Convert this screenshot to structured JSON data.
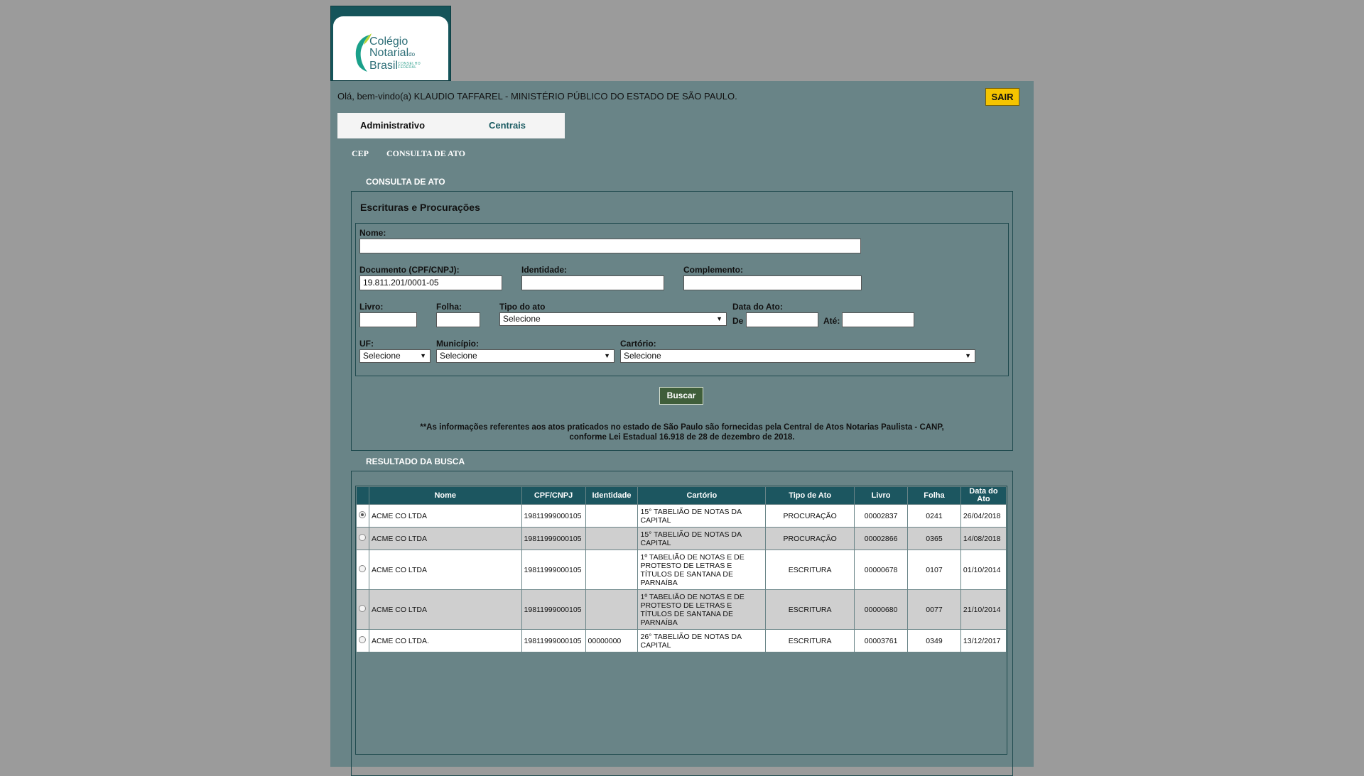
{
  "logo": {
    "line1": "Colégio",
    "line2": "Notarial",
    "line2_small": "do",
    "line3": "Brasil",
    "tag_line1": "CONSELHO",
    "tag_line2": "FEDERAL"
  },
  "header": {
    "welcome": "Olá, bem-vindo(a) KLAUDIO TAFFAREL - MINISTÉRIO PÚBLICO DO ESTADO DE SÃO PAULO.",
    "logout": "SAIR"
  },
  "tabs": [
    "Administrativo",
    "Centrais"
  ],
  "subnav": [
    "CEP",
    "CONSULTA DE ATO"
  ],
  "search": {
    "section_title": "CONSULTA DE ATO",
    "panel_title": "Escrituras e Procurações",
    "labels": {
      "nome": "Nome:",
      "documento": "Documento (CPF/CNPJ):",
      "identidade": "Identidade:",
      "complemento": "Complemento:",
      "livro": "Livro:",
      "folha": "Folha:",
      "tipo": "Tipo do ato",
      "data": "Data do Ato:",
      "de": "De",
      "ate": "Até:",
      "uf": "UF:",
      "municipio": "Município:",
      "cartorio": "Cartório:"
    },
    "values": {
      "nome": "",
      "documento": "19.811.201/0001-05",
      "identidade": "",
      "complemento": "",
      "livro": "",
      "folha": "",
      "data_de": "",
      "data_ate": ""
    },
    "selects": {
      "tipo": "Selecione",
      "uf": "Selecione",
      "municipio": "Selecione",
      "cartorio": "Selecione"
    },
    "button": "Buscar",
    "note_line1": "**As informações referentes aos atos praticados no estado de São Paulo são fornecidas pela Central de Atos Notarias Paulista - CANP,",
    "note_line2": "conforme Lei Estadual 16.918 de 28 de dezembro de 2018."
  },
  "results": {
    "section_title": "RESULTADO DA BUSCA",
    "columns": [
      "Nome",
      "CPF/CNPJ",
      "Identidade",
      "Cartório",
      "Tipo de Ato",
      "Livro",
      "Folha",
      "Data do Ato"
    ],
    "rows": [
      {
        "nome": "ACME CO LTDA",
        "cpf": "19811999000105",
        "identidade": "",
        "cartorio": "15° TABELIÃO DE NOTAS DA CAPITAL",
        "tipo": "PROCURAÇÃO",
        "livro": "00002837",
        "folha": "0241",
        "data": "26/04/2018",
        "selected": true
      },
      {
        "nome": "ACME CO LTDA",
        "cpf": "19811999000105",
        "identidade": "",
        "cartorio": "15° TABELIÃO DE NOTAS DA CAPITAL",
        "tipo": "PROCURAÇÃO",
        "livro": "00002866",
        "folha": "0365",
        "data": "14/08/2018",
        "selected": false
      },
      {
        "nome": "ACME CO LTDA",
        "cpf": "19811999000105",
        "identidade": "",
        "cartorio": "1º TABELIÃO DE NOTAS E DE PROTESTO DE LETRAS E TÍTULOS DE SANTANA DE PARNAÍBA",
        "tipo": "ESCRITURA",
        "livro": "00000678",
        "folha": "0107",
        "data": "01/10/2014",
        "selected": false
      },
      {
        "nome": "ACME CO LTDA",
        "cpf": "19811999000105",
        "identidade": "",
        "cartorio": "1º TABELIÃO DE NOTAS E DE PROTESTO DE LETRAS E TÍTULOS DE SANTANA DE PARNAÍBA",
        "tipo": "ESCRITURA",
        "livro": "00000680",
        "folha": "0077",
        "data": "21/10/2014",
        "selected": false
      },
      {
        "nome": "ACME CO LTDA.",
        "cpf": "19811999000105",
        "identidade": "00000000",
        "cartorio": "26° TABELIÃO DE NOTAS DA CAPITAL",
        "tipo": "ESCRITURA",
        "livro": "00003761",
        "folha": "0349",
        "data": "13/12/2017",
        "selected": false
      }
    ]
  }
}
